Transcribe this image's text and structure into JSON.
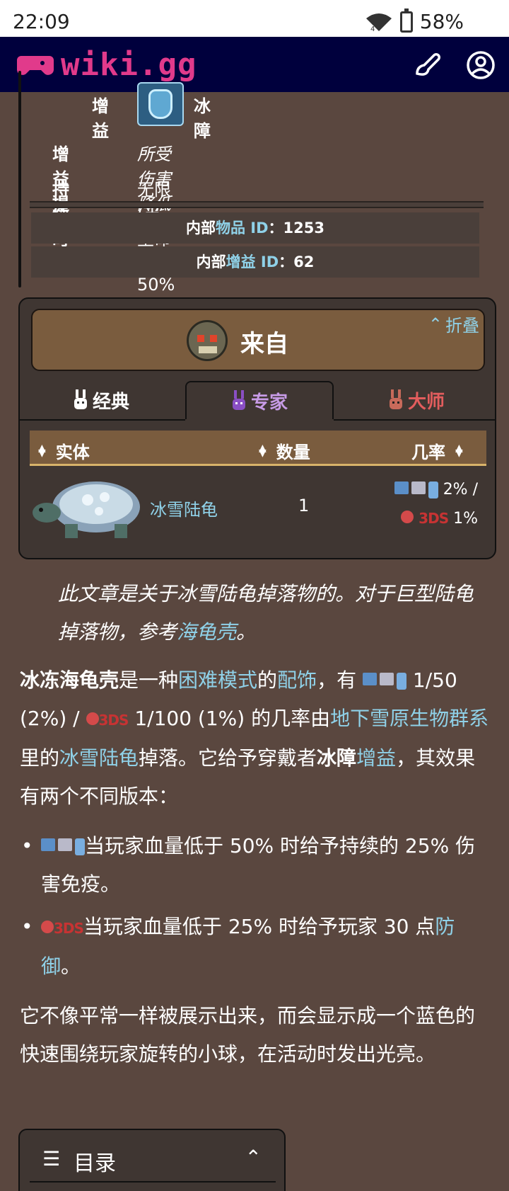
{
  "status_bar": {
    "time": "22:09",
    "battery": "58%"
  },
  "header": {
    "logo_text": "wiki.gg"
  },
  "info_card": {
    "buff_label": "增益",
    "buff_value": "冰障",
    "tip_label": "增益提示",
    "tip_value": "所受伤害降低25%",
    "duration_label": "持续时间",
    "duration_value": "无限(当生命低于50%时)",
    "item_id_prefix": "内部",
    "item_id_link": "物品 ID",
    "item_id_value": "：1253",
    "buff_id_prefix": "内部",
    "buff_id_link": "增益 ID",
    "buff_id_value": "：62"
  },
  "drops_card": {
    "title": "来自",
    "collapse": "折叠",
    "tabs": [
      {
        "label": "经典",
        "color": "#ffffff"
      },
      {
        "label": "专家",
        "color": "#c79be6"
      },
      {
        "label": "大师",
        "color": "#e25d5d"
      }
    ],
    "columns": [
      "实体",
      "数量",
      "几率"
    ],
    "rows": [
      {
        "entity": "冰雪陆龟",
        "quantity": "1",
        "chance_1": "2% /",
        "chance_2": "1%"
      }
    ]
  },
  "article": {
    "hatnote_1": "此文章是关于冰雪陆龟掉落物的。对于巨型陆龟掉落物，参考",
    "hatnote_link": "海龟壳",
    "hatnote_end": "。",
    "p1": {
      "bold": "冰冻海龟壳",
      "t1": "是一种",
      "link1": "困难模式",
      "t2": "的",
      "link2": "配饰",
      "t3": "，有",
      "t4": "1/50 (2%) /",
      "t5": "1/100 (1%) 的几率由",
      "link3": "地下雪原生物群系",
      "t6": "里的",
      "link4": "冰雪陆龟",
      "t7": "掉落。它给予穿戴者",
      "bold2": "冰障",
      "link5": "增益",
      "t8": "，其效果有两个不同版本："
    },
    "bullet1": "当玩家血量低于 50% 时给予持续的 25% 伤害免疫。",
    "bullet2_a": "当玩家血量低于 25% 时给予玩家 30 点",
    "bullet2_link": "防御",
    "bullet2_b": "。",
    "p2": "它不像平常一样被展示出来，而会显示成一个蓝色的快速围绕玩家旋转的小球，在活动时发出光亮。",
    "ds_label": "3DS"
  },
  "toc": {
    "title": "目录"
  }
}
